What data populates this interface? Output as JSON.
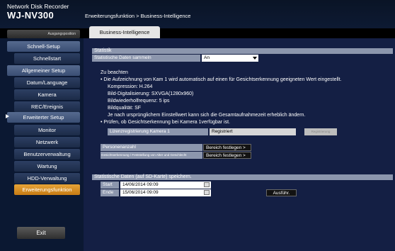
{
  "header": {
    "product": "Network Disk Recorder",
    "model": "WJ-NV300",
    "breadcrumb": "Erweiterungsfunktion > Business-Intelligence",
    "setup_button": "Ausgangsposition"
  },
  "sidebar": {
    "items": [
      {
        "label": "Schnell-Setup"
      },
      {
        "label": "Schnellstart"
      },
      {
        "label": "Allgemeiner Setup"
      },
      {
        "label": "Datum/Language"
      },
      {
        "label": "Kamera"
      },
      {
        "label": "REC/Ereignis"
      },
      {
        "label": "Erweiterter Setup"
      },
      {
        "label": "Monitor"
      },
      {
        "label": "Netzwerk"
      },
      {
        "label": "Benutzerverwaltung"
      },
      {
        "label": "Wartung"
      },
      {
        "label": "HDD-Verwaltung"
      },
      {
        "label": "Erweiterungsfunktion"
      }
    ],
    "exit": "Exit"
  },
  "tab": {
    "label": "Business-Intelligence"
  },
  "statistik": {
    "title": "Statistik",
    "collect_label": "Statistische Daten sammeln",
    "collect_value": "An"
  },
  "notes": {
    "heading": "Zu beachten",
    "line1": "• Die Aufzeichnung von Kam 1 wird automatisch auf einen für Gesichtserkennung geeigneten Wert eingestellt.",
    "line2": "Kompression: H.264",
    "line3": "Bild-Digitalisierung: SXVGA(1280x960)",
    "line4": "Bildwiederholfrequenz: 5 ips",
    "line5": "Bildqualität: SF",
    "line6": "Je nach ursprünglichem Einstellwert kann sich die Gesamtaufnahmezeit erheblich ändern.",
    "line7": "• Prüfen, ob Gesichtserkennung bei Kamera 1verfügbar ist."
  },
  "license": {
    "label": "Lizenzregistrierung Kamera 1",
    "value": "Registriert",
    "button": "Registrierung"
  },
  "areas": {
    "person_label": "Personenanzahl",
    "person_button": "Bereich festlegen >",
    "face_label": "Gesichtserkennung / Feststellung von Alter und Geschlecht",
    "face_button": "Bereich festlegen >"
  },
  "save": {
    "title": "Statistische Daten (auf SD-Karte) speichern.",
    "start_label": "Start",
    "start_value": "14/06/2014 09:09",
    "end_label": "Ende",
    "end_value": "15/06/2014 09:09",
    "execute": "Ausführ."
  }
}
